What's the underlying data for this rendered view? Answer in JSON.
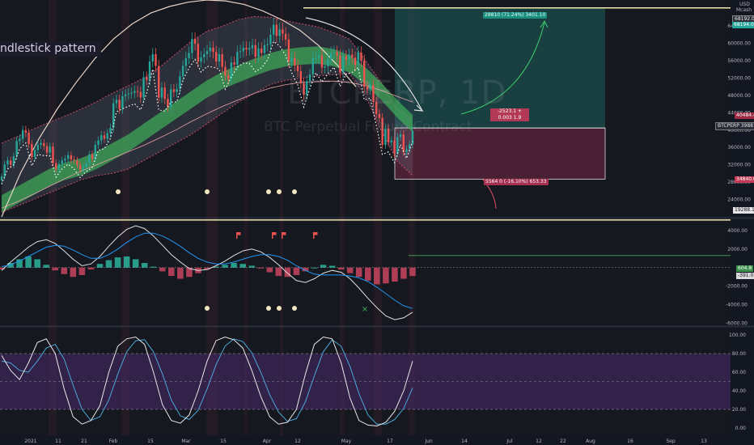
{
  "overlay": {
    "pattern_label": "ndlestick pattern",
    "watermark_symbol": "BTCPERP, 1D",
    "watermark_desc": "BTC Perpetual Future Contract"
  },
  "colors": {
    "background": "#131722",
    "up": "#26a69a",
    "down": "#ef5350",
    "band": "#c94a6a",
    "ribbon": "#3fae5a",
    "target_zone": "#1f6f6a",
    "stop_zone": "#8b2d4d",
    "stoch_zone": "#4a2a6a",
    "macd_line": "#e0e0e0",
    "signal_line": "#2196f3"
  },
  "axis_top": {
    "currency": "USD",
    "unit": "Mcash"
  },
  "chart_data": [
    {
      "type": "candlestick",
      "title": "BTCPERP, 1D",
      "subtitle": "BTC Perpetual Future Contract",
      "y_ticks": [
        64000,
        60000,
        56000,
        52000,
        48000,
        44000,
        40000,
        36000,
        32000,
        28000,
        24000
      ],
      "ylim": [
        20000,
        70000
      ],
      "x_ticks": [
        "2021",
        "11",
        "21",
        "Feb",
        "15",
        "Mar",
        "15",
        "Apr",
        "12",
        "May",
        "17",
        "Jun",
        "14",
        "Jul",
        "12",
        "22",
        "Aug",
        "16",
        "Sep",
        "13"
      ],
      "tags": {
        "price": "BTCPERP 39881.4",
        "target": "68192.0",
        "target_right": "68194.0",
        "stop": "34840.0",
        "level_low": "19288.1",
        "entry_level": "40484.4",
        "profit_label": "28810 (71.24%) 3401.10",
        "position_label": "-2523.1 + 0.003 1.9",
        "loss_label": "5564 0 (-16.10%) 653.33"
      },
      "close": [
        29300,
        32100,
        33000,
        32000,
        34000,
        37500,
        38000,
        40000,
        39400,
        36800,
        33800,
        35400,
        36600,
        37000,
        36300,
        34800,
        36200,
        32400,
        31000,
        32200,
        33000,
        33400,
        34200,
        33200,
        33000,
        32000,
        30900,
        31500,
        32400,
        34400,
        33400,
        36600,
        37600,
        38800,
        38000,
        39300,
        40500,
        46200,
        47000,
        44900,
        47800,
        48200,
        48400,
        48600,
        49000,
        48800,
        47500,
        52200,
        51600,
        55800,
        57500,
        54800,
        47500,
        49800,
        47200,
        45300,
        49400,
        48800,
        49500,
        52400,
        54800,
        56600,
        57800,
        61000,
        59900,
        55800,
        56800,
        57500,
        58200,
        59000,
        58000,
        55800,
        57500,
        54600,
        52600,
        51800,
        55600,
        55100,
        58000,
        58200,
        59000,
        58600,
        58900,
        59600,
        56900,
        58800,
        57800,
        59600,
        59800,
        62000,
        64300,
        61700,
        63200,
        62200,
        60900,
        55800,
        56600,
        54900,
        53600,
        50800,
        48200,
        51300,
        52800,
        56600,
        56600,
        57200,
        54400,
        54700,
        56400,
        57800,
        58000,
        57200,
        53300,
        57000,
        56300,
        57400,
        56700,
        55000,
        57900,
        56000,
        50000,
        49400,
        50400,
        46500,
        43700,
        42800,
        36600,
        40300,
        37200,
        37600,
        34600,
        38400,
        39000,
        34900,
        35600,
        36700,
        39800
      ],
      "bands_upper": [
        37000,
        38500,
        40200,
        41800,
        43200,
        44800,
        46500,
        48500,
        50200,
        52000,
        54500,
        57500,
        60500,
        62800,
        64000,
        65500,
        66200,
        66000,
        65200,
        64500,
        63800,
        62500,
        61000,
        56200,
        51000,
        45000,
        42600
      ],
      "bands_lower": [
        21000,
        22500,
        24000,
        25500,
        27000,
        28500,
        29500,
        30000,
        31000,
        33000,
        35000,
        37000,
        39000,
        41500,
        44000,
        46500,
        48500,
        50500,
        51500,
        52000,
        52500,
        52800,
        53000,
        48000,
        40000,
        33000,
        29500
      ],
      "ribbon_mid": [
        23500,
        25500,
        27500,
        29500,
        31000,
        32000,
        33500,
        35500,
        37500,
        40000,
        42500,
        45000,
        47500,
        50000,
        52000,
        53500,
        55000,
        56300,
        57200,
        57600,
        57800,
        57200,
        55800,
        53000,
        49500,
        45500,
        42000
      ],
      "ma_slow": [
        22000,
        23500,
        25200,
        27000,
        28800,
        30500,
        32000,
        33500,
        35000,
        36500,
        38200,
        40000,
        42000,
        43800,
        45500,
        47000,
        48500,
        49700,
        50500,
        51000,
        51200,
        51300,
        51000,
        50300,
        49200,
        47800,
        46500
      ],
      "arc_ma": [
        20000,
        30000,
        38000,
        45000,
        51000,
        56500,
        61000,
        64500,
        67000,
        68500,
        69500,
        70000,
        69800,
        69000,
        67500,
        65500,
        63000,
        59500,
        55000,
        50000
      ]
    },
    {
      "type": "bar",
      "title": "MACD",
      "y_ticks": [
        4000,
        2000,
        0,
        -2000,
        -4000,
        -6000
      ],
      "ylim": [
        -6200,
        5200
      ],
      "tags": {
        "macd": "604.8",
        "signal": "-391.0"
      },
      "histogram": [
        -200,
        500,
        900,
        1200,
        900,
        300,
        -300,
        -700,
        -1000,
        -800,
        -200,
        400,
        800,
        1100,
        1200,
        900,
        500,
        100,
        -400,
        -900,
        -1200,
        -1000,
        -600,
        -200,
        100,
        300,
        500,
        400,
        200,
        -100,
        -500,
        -900,
        -1000,
        -800,
        -400,
        0,
        300,
        200,
        -200,
        -600,
        -1000,
        -1400,
        -1800,
        -1700,
        -1500,
        -1200,
        -900
      ],
      "macd_line": [
        -300,
        600,
        1400,
        2200,
        2800,
        3000,
        2600,
        1800,
        900,
        200,
        400,
        1200,
        2300,
        3300,
        4100,
        4500,
        4200,
        3400,
        2400,
        1400,
        600,
        -100,
        -300,
        -200,
        200,
        700,
        1300,
        1800,
        2000,
        1700,
        1100,
        300,
        -600,
        -1400,
        -1600,
        -1200,
        -600,
        -300,
        -500,
        -1200,
        -2200,
        -3300,
        -4300,
        -5200,
        -5600,
        -5400,
        -4800
      ],
      "signal_line": [
        100,
        300,
        700,
        1200,
        1700,
        2200,
        2400,
        2300,
        1900,
        1400,
        1000,
        1000,
        1400,
        2000,
        2700,
        3300,
        3700,
        3700,
        3400,
        2900,
        2300,
        1600,
        1000,
        600,
        400,
        400,
        600,
        900,
        1200,
        1400,
        1400,
        1200,
        800,
        200,
        -300,
        -700,
        -800,
        -800,
        -800,
        -900,
        -1100,
        -1500,
        -2100,
        -2800,
        -3500,
        -4100,
        -4400
      ]
    },
    {
      "type": "line",
      "title": "Stochastic RSI",
      "y_ticks": [
        100,
        80,
        60,
        40,
        20,
        0
      ],
      "ylim": [
        -8,
        108
      ],
      "k": [
        78,
        62,
        52,
        70,
        92,
        96,
        80,
        42,
        12,
        4,
        8,
        24,
        60,
        88,
        96,
        98,
        90,
        60,
        25,
        8,
        5,
        14,
        40,
        72,
        94,
        98,
        95,
        86,
        62,
        34,
        12,
        4,
        6,
        20,
        58,
        90,
        98,
        96,
        70,
        32,
        8,
        3,
        2,
        6,
        18,
        40,
        72
      ],
      "d": [
        72,
        70,
        62,
        60,
        72,
        86,
        90,
        74,
        46,
        20,
        8,
        12,
        30,
        58,
        82,
        94,
        95,
        82,
        58,
        30,
        13,
        9,
        19,
        42,
        68,
        88,
        96,
        93,
        81,
        60,
        36,
        17,
        7,
        10,
        28,
        56,
        82,
        95,
        88,
        66,
        37,
        14,
        4,
        4,
        9,
        21,
        43
      ]
    }
  ]
}
